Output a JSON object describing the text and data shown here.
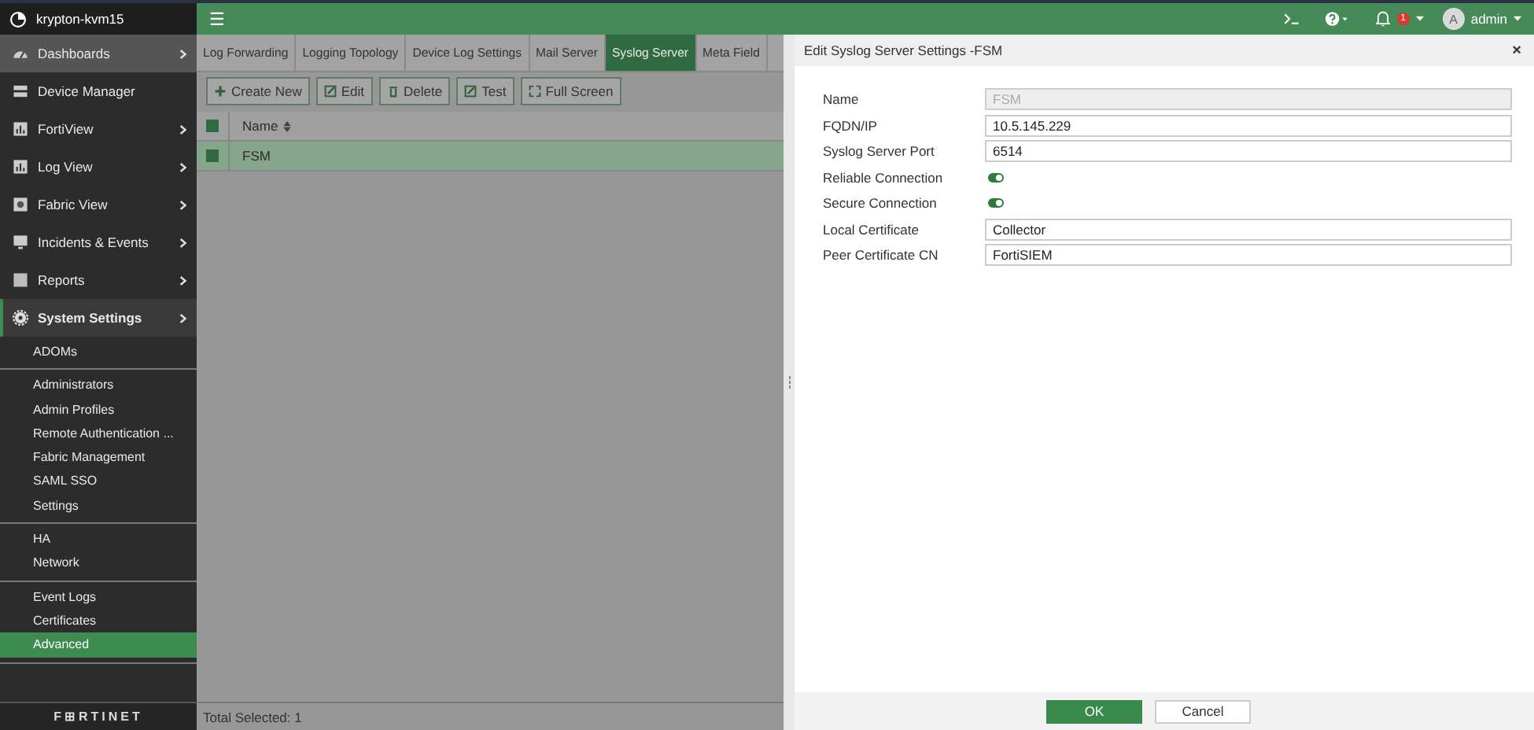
{
  "host": {
    "name": "krypton-kvm15"
  },
  "nav": [
    {
      "label": "Dashboards",
      "expandable": true,
      "selected": false,
      "hover": true
    },
    {
      "label": "Device Manager",
      "expandable": false,
      "selected": false,
      "hover": false
    },
    {
      "label": "FortiView",
      "expandable": true,
      "selected": false,
      "hover": false
    },
    {
      "label": "Log View",
      "expandable": true,
      "selected": false,
      "hover": false
    },
    {
      "label": "Fabric View",
      "expandable": true,
      "selected": false,
      "hover": false
    },
    {
      "label": "Incidents & Events",
      "expandable": true,
      "selected": false,
      "hover": false
    },
    {
      "label": "Reports",
      "expandable": true,
      "selected": false,
      "hover": false
    },
    {
      "label": "System Settings",
      "expandable": true,
      "selected": true,
      "hover": false
    }
  ],
  "subnav": [
    [
      {
        "label": "ADOMs",
        "selected": false
      }
    ],
    [
      {
        "label": "Administrators",
        "selected": false
      },
      {
        "label": "Admin Profiles",
        "selected": false
      },
      {
        "label": "Remote Authentication ...",
        "selected": false
      },
      {
        "label": "Fabric Management",
        "selected": false
      },
      {
        "label": "SAML SSO",
        "selected": false
      },
      {
        "label": "Settings",
        "selected": false
      }
    ],
    [
      {
        "label": "HA",
        "selected": false
      },
      {
        "label": "Network",
        "selected": false
      }
    ],
    [
      {
        "label": "Event Logs",
        "selected": false
      },
      {
        "label": "Certificates",
        "selected": false
      },
      {
        "label": "Advanced",
        "selected": true
      }
    ]
  ],
  "brand": "F⊞RTINET",
  "header": {
    "menu": "☰",
    "user_initial": "A",
    "user": "admin",
    "alerts": "1"
  },
  "tabs": [
    {
      "label": "Log Forwarding",
      "selected": false
    },
    {
      "label": "Logging Topology",
      "selected": false
    },
    {
      "label": "Device Log Settings",
      "selected": false
    },
    {
      "label": "Mail Server",
      "selected": false
    },
    {
      "label": "Syslog Server",
      "selected": true
    },
    {
      "label": "Meta Field",
      "selected": false
    }
  ],
  "toolbar": [
    {
      "label": "Create New"
    },
    {
      "label": "Edit"
    },
    {
      "label": "Delete"
    },
    {
      "label": "Test"
    },
    {
      "label": "Full Screen"
    }
  ],
  "table": {
    "all_checked": true,
    "columns": [
      "Name"
    ],
    "rows": [
      {
        "cells": [
          "FSM"
        ],
        "checked": true,
        "selected": true
      }
    ]
  },
  "status_bar": "Total Selected: 1",
  "dialog": {
    "title": "Edit Syslog Server Settings -FSM",
    "close": "×",
    "fields": [
      {
        "kind": "text",
        "label": "Name",
        "value": "FSM",
        "disabled": true
      },
      {
        "kind": "text",
        "label": "FQDN/IP",
        "value": "10.5.145.229",
        "disabled": false
      },
      {
        "kind": "text",
        "label": "Syslog Server Port",
        "value": "6514",
        "disabled": false
      },
      {
        "kind": "toggle",
        "label": "Reliable Connection",
        "on": true
      },
      {
        "kind": "toggle",
        "label": "Secure Connection",
        "on": true
      },
      {
        "kind": "text",
        "label": "Local Certificate",
        "value": "Collector",
        "disabled": false
      },
      {
        "kind": "text",
        "label": "Peer Certificate CN",
        "value": "FortiSIEM",
        "disabled": false
      }
    ],
    "buttons": [
      "OK",
      "Cancel"
    ]
  }
}
